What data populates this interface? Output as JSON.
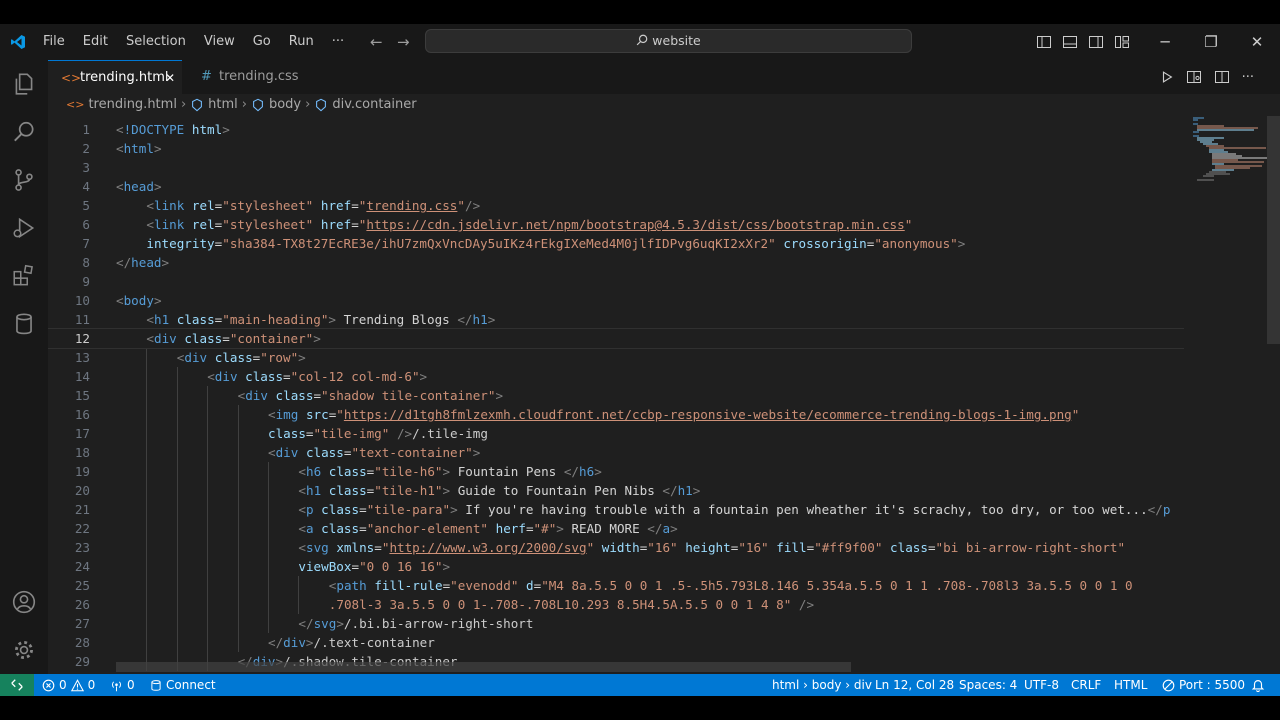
{
  "menu": [
    "File",
    "Edit",
    "Selection",
    "View",
    "Go",
    "Run",
    "···"
  ],
  "search": {
    "text": "website"
  },
  "tabs": [
    {
      "label": "trending.html",
      "icon": "<>",
      "active": true,
      "close": "✕"
    },
    {
      "label": "trending.css",
      "icon": "#",
      "active": false
    }
  ],
  "breadcrumb": [
    "trending.html",
    "html",
    "body",
    "div.container"
  ],
  "code": {
    "current_line": 12,
    "lines": [
      {
        "n": "1",
        "ind": 0,
        "t": [
          [
            "punc",
            "<"
          ],
          [
            "tag",
            "!DOCTYPE"
          ],
          [
            "text",
            " "
          ],
          [
            "attr",
            "html"
          ],
          [
            "punc",
            ">"
          ]
        ]
      },
      {
        "n": "2",
        "ind": 0,
        "t": [
          [
            "punc",
            "<"
          ],
          [
            "tag",
            "html"
          ],
          [
            "punc",
            ">"
          ]
        ]
      },
      {
        "n": "3",
        "ind": 0,
        "t": []
      },
      {
        "n": "4",
        "ind": 0,
        "t": [
          [
            "punc",
            "<"
          ],
          [
            "tag",
            "head"
          ],
          [
            "punc",
            ">"
          ]
        ]
      },
      {
        "n": "5",
        "ind": 1,
        "t": [
          [
            "punc",
            "<"
          ],
          [
            "tag",
            "link"
          ],
          [
            "text",
            " "
          ],
          [
            "attr",
            "rel"
          ],
          [
            "text",
            "="
          ],
          [
            "str",
            "\"stylesheet\""
          ],
          [
            "text",
            " "
          ],
          [
            "attr",
            "href"
          ],
          [
            "text",
            "="
          ],
          [
            "str",
            "\""
          ],
          [
            "link",
            "trending.css"
          ],
          [
            "str",
            "\""
          ],
          [
            "punc",
            "/>"
          ]
        ]
      },
      {
        "n": "6",
        "ind": 1,
        "t": [
          [
            "punc",
            "<"
          ],
          [
            "tag",
            "link"
          ],
          [
            "text",
            " "
          ],
          [
            "attr",
            "rel"
          ],
          [
            "text",
            "="
          ],
          [
            "str",
            "\"stylesheet\""
          ],
          [
            "text",
            " "
          ],
          [
            "attr",
            "href"
          ],
          [
            "text",
            "="
          ],
          [
            "str",
            "\""
          ],
          [
            "link",
            "https://cdn.jsdelivr.net/npm/bootstrap@4.5.3/dist/css/bootstrap.min.css"
          ],
          [
            "str",
            "\""
          ]
        ]
      },
      {
        "n": "7",
        "ind": 1,
        "t": [
          [
            "attr",
            "integrity"
          ],
          [
            "text",
            "="
          ],
          [
            "str",
            "\"sha384-TX8t27EcRE3e/ihU7zmQxVncDAy5uIKz4rEkgIXeMed4M0jlfIDPvg6uqKI2xXr2\""
          ],
          [
            "text",
            " "
          ],
          [
            "attr",
            "crossorigin"
          ],
          [
            "text",
            "="
          ],
          [
            "str",
            "\"anonymous\""
          ],
          [
            "punc",
            ">"
          ]
        ]
      },
      {
        "n": "8",
        "ind": 0,
        "t": [
          [
            "punc",
            "</"
          ],
          [
            "tag",
            "head"
          ],
          [
            "punc",
            ">"
          ]
        ]
      },
      {
        "n": "9",
        "ind": 0,
        "t": []
      },
      {
        "n": "10",
        "ind": 0,
        "t": [
          [
            "punc",
            "<"
          ],
          [
            "tag",
            "body"
          ],
          [
            "punc",
            ">"
          ]
        ]
      },
      {
        "n": "11",
        "ind": 1,
        "t": [
          [
            "punc",
            "<"
          ],
          [
            "tag",
            "h1"
          ],
          [
            "text",
            " "
          ],
          [
            "attr",
            "class"
          ],
          [
            "text",
            "="
          ],
          [
            "str",
            "\"main-heading\""
          ],
          [
            "punc",
            ">"
          ],
          [
            "text",
            " Trending Blogs "
          ],
          [
            "punc",
            "</"
          ],
          [
            "tag",
            "h1"
          ],
          [
            "punc",
            ">"
          ]
        ]
      },
      {
        "n": "12",
        "ind": 1,
        "t": [
          [
            "punc",
            "<"
          ],
          [
            "tag",
            "div"
          ],
          [
            "text",
            " "
          ],
          [
            "attr",
            "class"
          ],
          [
            "text",
            "="
          ],
          [
            "str",
            "\"container\""
          ],
          [
            "punc",
            ">"
          ]
        ]
      },
      {
        "n": "13",
        "ind": 2,
        "t": [
          [
            "punc",
            "<"
          ],
          [
            "tag",
            "div"
          ],
          [
            "text",
            " "
          ],
          [
            "attr",
            "class"
          ],
          [
            "text",
            "="
          ],
          [
            "str",
            "\"row\""
          ],
          [
            "punc",
            ">"
          ]
        ]
      },
      {
        "n": "14",
        "ind": 3,
        "t": [
          [
            "punc",
            "<"
          ],
          [
            "tag",
            "div"
          ],
          [
            "text",
            " "
          ],
          [
            "attr",
            "class"
          ],
          [
            "text",
            "="
          ],
          [
            "str",
            "\"col-12 col-md-6\""
          ],
          [
            "punc",
            ">"
          ]
        ]
      },
      {
        "n": "15",
        "ind": 4,
        "t": [
          [
            "punc",
            "<"
          ],
          [
            "tag",
            "div"
          ],
          [
            "text",
            " "
          ],
          [
            "attr",
            "class"
          ],
          [
            "text",
            "="
          ],
          [
            "str",
            "\"shadow tile-container\""
          ],
          [
            "punc",
            ">"
          ]
        ]
      },
      {
        "n": "16",
        "ind": 5,
        "t": [
          [
            "punc",
            "<"
          ],
          [
            "tag",
            "img"
          ],
          [
            "text",
            " "
          ],
          [
            "attr",
            "src"
          ],
          [
            "text",
            "="
          ],
          [
            "str",
            "\""
          ],
          [
            "link",
            "https://d1tgh8fmlzexmh.cloudfront.net/ccbp-responsive-website/ecommerce-trending-blogs-1-img.png"
          ],
          [
            "str",
            "\""
          ]
        ]
      },
      {
        "n": "17",
        "ind": 5,
        "t": [
          [
            "attr",
            "class"
          ],
          [
            "text",
            "="
          ],
          [
            "str",
            "\"tile-img\""
          ],
          [
            "text",
            " "
          ],
          [
            "punc",
            "/>"
          ],
          [
            "cmt",
            "/.tile-img"
          ]
        ]
      },
      {
        "n": "18",
        "ind": 5,
        "t": [
          [
            "punc",
            "<"
          ],
          [
            "tag",
            "div"
          ],
          [
            "text",
            " "
          ],
          [
            "attr",
            "class"
          ],
          [
            "text",
            "="
          ],
          [
            "str",
            "\"text-container\""
          ],
          [
            "punc",
            ">"
          ]
        ]
      },
      {
        "n": "19",
        "ind": 6,
        "t": [
          [
            "punc",
            "<"
          ],
          [
            "tag",
            "h6"
          ],
          [
            "text",
            " "
          ],
          [
            "attr",
            "class"
          ],
          [
            "text",
            "="
          ],
          [
            "str",
            "\"tile-h6\""
          ],
          [
            "punc",
            ">"
          ],
          [
            "text",
            " Fountain Pens "
          ],
          [
            "punc",
            "</"
          ],
          [
            "tag",
            "h6"
          ],
          [
            "punc",
            ">"
          ]
        ]
      },
      {
        "n": "20",
        "ind": 6,
        "t": [
          [
            "punc",
            "<"
          ],
          [
            "tag",
            "h1"
          ],
          [
            "text",
            " "
          ],
          [
            "attr",
            "class"
          ],
          [
            "text",
            "="
          ],
          [
            "str",
            "\"tile-h1\""
          ],
          [
            "punc",
            ">"
          ],
          [
            "text",
            " Guide to Fountain Pen Nibs "
          ],
          [
            "punc",
            "</"
          ],
          [
            "tag",
            "h1"
          ],
          [
            "punc",
            ">"
          ]
        ]
      },
      {
        "n": "21",
        "ind": 6,
        "t": [
          [
            "punc",
            "<"
          ],
          [
            "tag",
            "p"
          ],
          [
            "text",
            " "
          ],
          [
            "attr",
            "class"
          ],
          [
            "text",
            "="
          ],
          [
            "str",
            "\"tile-para\""
          ],
          [
            "punc",
            ">"
          ],
          [
            "text",
            " If you're having trouble with a fountain pen wheather it's scrachy, too dry, or too wet..."
          ],
          [
            "punc",
            "</"
          ],
          [
            "tag",
            "p"
          ]
        ]
      },
      {
        "n": "22",
        "ind": 6,
        "t": [
          [
            "punc",
            "<"
          ],
          [
            "tag",
            "a"
          ],
          [
            "text",
            " "
          ],
          [
            "attr",
            "class"
          ],
          [
            "text",
            "="
          ],
          [
            "str",
            "\"anchor-element\""
          ],
          [
            "text",
            " "
          ],
          [
            "attr",
            "herf"
          ],
          [
            "text",
            "="
          ],
          [
            "str",
            "\"#\""
          ],
          [
            "punc",
            ">"
          ],
          [
            "text",
            " READ MORE "
          ],
          [
            "punc",
            "</"
          ],
          [
            "tag",
            "a"
          ],
          [
            "punc",
            ">"
          ]
        ]
      },
      {
        "n": "23",
        "ind": 6,
        "t": [
          [
            "punc",
            "<"
          ],
          [
            "tag",
            "svg"
          ],
          [
            "text",
            " "
          ],
          [
            "attr",
            "xmlns"
          ],
          [
            "text",
            "="
          ],
          [
            "str",
            "\""
          ],
          [
            "link",
            "http://www.w3.org/2000/svg"
          ],
          [
            "str",
            "\""
          ],
          [
            "text",
            " "
          ],
          [
            "attr",
            "width"
          ],
          [
            "text",
            "="
          ],
          [
            "str",
            "\"16\""
          ],
          [
            "text",
            " "
          ],
          [
            "attr",
            "height"
          ],
          [
            "text",
            "="
          ],
          [
            "str",
            "\"16\""
          ],
          [
            "text",
            " "
          ],
          [
            "attr",
            "fill"
          ],
          [
            "text",
            "="
          ],
          [
            "str",
            "\"#ff9f00\""
          ],
          [
            "text",
            " "
          ],
          [
            "attr",
            "class"
          ],
          [
            "text",
            "="
          ],
          [
            "str",
            "\"bi bi-arrow-right-short\""
          ]
        ]
      },
      {
        "n": "24",
        "ind": 6,
        "t": [
          [
            "attr",
            "viewBox"
          ],
          [
            "text",
            "="
          ],
          [
            "str",
            "\"0 0 16 16\""
          ],
          [
            "punc",
            ">"
          ]
        ]
      },
      {
        "n": "25",
        "ind": 7,
        "t": [
          [
            "punc",
            "<"
          ],
          [
            "tag",
            "path"
          ],
          [
            "text",
            " "
          ],
          [
            "attr",
            "fill-rule"
          ],
          [
            "text",
            "="
          ],
          [
            "str",
            "\"evenodd\""
          ],
          [
            "text",
            " "
          ],
          [
            "attr",
            "d"
          ],
          [
            "text",
            "="
          ],
          [
            "str",
            "\"M4 8a.5.5 0 0 1 .5-.5h5.793L8.146 5.354a.5.5 0 1 1 .708-.708l3 3a.5.5 0 0 1 0"
          ]
        ]
      },
      {
        "n": "26",
        "ind": 7,
        "t": [
          [
            "str",
            ".708l-3 3a.5.5 0 0 1-.708-.708L10.293 8.5H4.5A.5.5 0 0 1 4 8\""
          ],
          [
            "text",
            " "
          ],
          [
            "punc",
            "/>"
          ]
        ]
      },
      {
        "n": "27",
        "ind": 6,
        "t": [
          [
            "punc",
            "</"
          ],
          [
            "tag",
            "svg"
          ],
          [
            "punc",
            ">"
          ],
          [
            "cmt",
            "/.bi.bi-arrow-right-short"
          ]
        ]
      },
      {
        "n": "28",
        "ind": 5,
        "t": [
          [
            "punc",
            "</"
          ],
          [
            "tag",
            "div"
          ],
          [
            "punc",
            ">"
          ],
          [
            "cmt",
            "/.text-container"
          ]
        ]
      },
      {
        "n": "29",
        "ind": 4,
        "t": [
          [
            "punc",
            "</"
          ],
          [
            "tag",
            "div"
          ],
          [
            "punc",
            ">"
          ],
          [
            "cmt",
            "/.shadow.tile-container"
          ]
        ]
      }
    ]
  },
  "status": {
    "errors": "0",
    "warnings": "0",
    "ports": "0",
    "connect": "Connect",
    "path": "html › body › div",
    "position": "Ln 12, Col 28",
    "spaces": "Spaces: 4",
    "encoding": "UTF-8",
    "eol": "CRLF",
    "language": "HTML",
    "port": "Port : 5500"
  },
  "colors": {
    "editor_bg": "#1f1f1f",
    "chrome_bg": "#181818",
    "status_bg": "#0078d4",
    "remote_bg": "#16825d",
    "accent": "#0078d4"
  },
  "icons": {
    "logo": "vscode-logo-icon",
    "activity": [
      "explorer-icon",
      "search-icon",
      "source-control-icon",
      "run-debug-icon",
      "extensions-icon",
      "database-icon",
      "account-icon",
      "settings-gear-icon"
    ]
  }
}
